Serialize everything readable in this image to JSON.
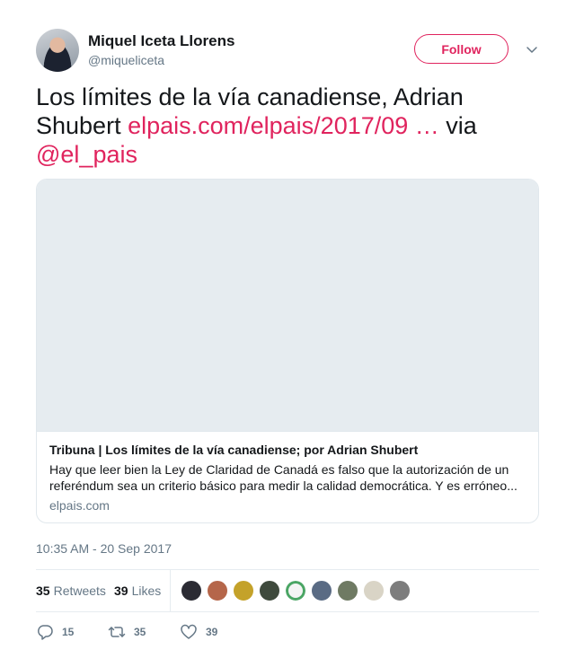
{
  "author": {
    "name": "Miquel Iceta Llorens",
    "handle": "@miqueliceta",
    "follow_label": "Follow"
  },
  "tweet": {
    "text_plain": "Los límites de la vía canadiense, Adrian Shubert ",
    "link": "elpais.com/elpais/2017/09",
    "ellipsis": " …",
    "via": " via ",
    "mention": "@el_pais"
  },
  "card": {
    "title": "Tribuna | Los límites de la vía canadiense; por Adrian Shubert",
    "description": "Hay que leer bien la Ley de Claridad de Canadá es falso que la autorización de un referéndum sea un criterio básico para medir la calidad democrática. Y es erróneo...",
    "domain": "elpais.com"
  },
  "timestamp": "10:35 AM - 20 Sep 2017",
  "stats": {
    "retweets_count": "35",
    "retweets_label": "Retweets",
    "likes_count": "39",
    "likes_label": "Likes"
  },
  "likers": [
    {
      "name": "liker-avatar-1",
      "color": "#2b2b33"
    },
    {
      "name": "liker-avatar-2",
      "color": "#b5664a"
    },
    {
      "name": "liker-avatar-3",
      "color": "#c4a22a"
    },
    {
      "name": "liker-avatar-4",
      "color": "#3f4a3d"
    },
    {
      "name": "liker-avatar-5",
      "color": "#f4f4f4"
    },
    {
      "name": "liker-avatar-6",
      "color": "#5a6b84"
    },
    {
      "name": "liker-avatar-7",
      "color": "#6f7a63"
    },
    {
      "name": "liker-avatar-8",
      "color": "#d9d4c6"
    },
    {
      "name": "liker-avatar-9",
      "color": "#7d7d7d"
    }
  ],
  "actions": {
    "reply_count": "15",
    "retweet_count": "35",
    "like_count": "39"
  },
  "colors": {
    "accent": "#e0245e",
    "muted": "#657786",
    "text": "#14171a",
    "border": "#e1e8ed"
  }
}
